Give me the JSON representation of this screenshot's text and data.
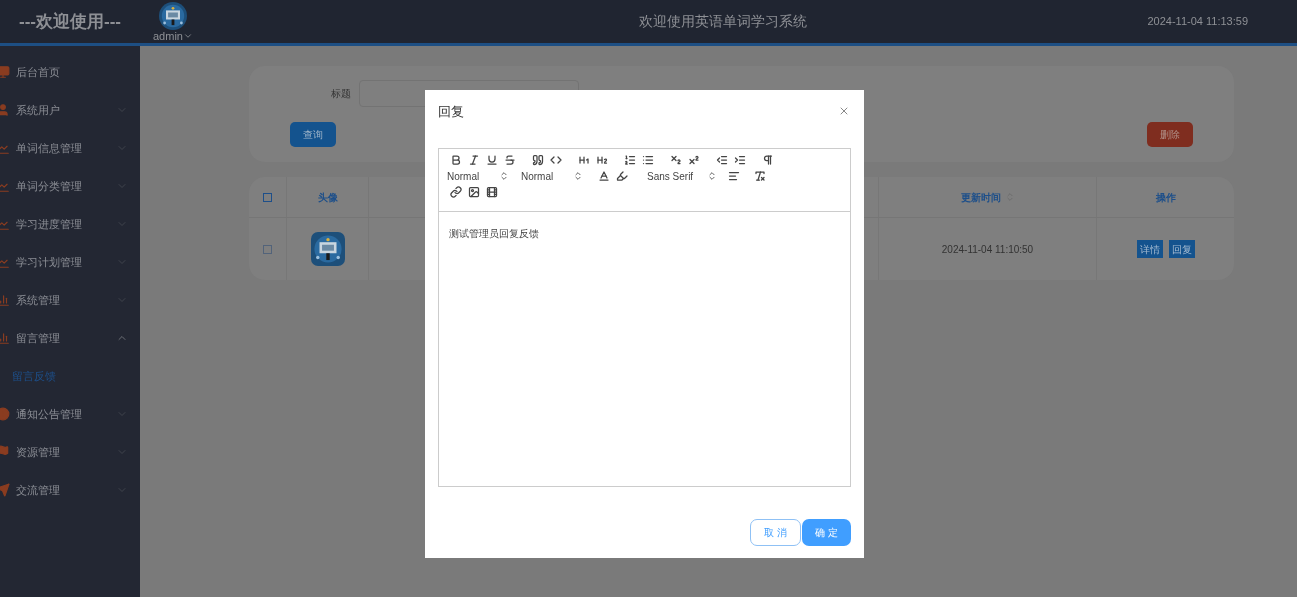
{
  "header": {
    "brand": "---欢迎使用---",
    "user": "admin",
    "title": "欢迎使用英语单词学习系统",
    "datetime": "2024-11-04 11:13:59"
  },
  "sidebar": {
    "items": [
      {
        "label": "后台首页",
        "has_arrow": false
      },
      {
        "label": "系统用户",
        "expanded": false,
        "has_arrow": true
      },
      {
        "label": "单词信息管理",
        "expanded": false,
        "has_arrow": true
      },
      {
        "label": "单词分类管理",
        "expanded": false,
        "has_arrow": true
      },
      {
        "label": "学习进度管理",
        "expanded": false,
        "has_arrow": true
      },
      {
        "label": "学习计划管理",
        "expanded": false,
        "has_arrow": true
      },
      {
        "label": "系统管理",
        "expanded": false,
        "has_arrow": true
      },
      {
        "label": "留言管理",
        "expanded": true,
        "has_arrow": true,
        "children": [
          {
            "label": "留言反馈",
            "selected": true
          }
        ]
      },
      {
        "label": "通知公告管理",
        "expanded": false,
        "has_arrow": true
      },
      {
        "label": "资源管理",
        "expanded": false,
        "has_arrow": true
      },
      {
        "label": "交流管理",
        "expanded": false,
        "has_arrow": true
      }
    ]
  },
  "search": {
    "label": "标题",
    "query_button": "查询",
    "delete_button": "删除"
  },
  "table": {
    "columns": [
      {
        "kind": "checkbox",
        "checked": false
      },
      {
        "kind": "text",
        "label": "头像",
        "sortable": false
      },
      {
        "kind": "hidden"
      },
      {
        "kind": "text",
        "label": "更新时间",
        "sortable": true
      },
      {
        "kind": "text",
        "label": "操作",
        "sortable": false
      }
    ],
    "rows": [
      {
        "checked": false,
        "updated": "2024-11-04 11:10:50",
        "actions": [
          "详情",
          "回复"
        ]
      }
    ]
  },
  "dialog": {
    "title": "回复",
    "pickers": [
      "Normal",
      "Normal",
      "Sans Serif"
    ],
    "content": "测试管理员回复反馈",
    "cancel": "取 消",
    "confirm": "确 定"
  }
}
